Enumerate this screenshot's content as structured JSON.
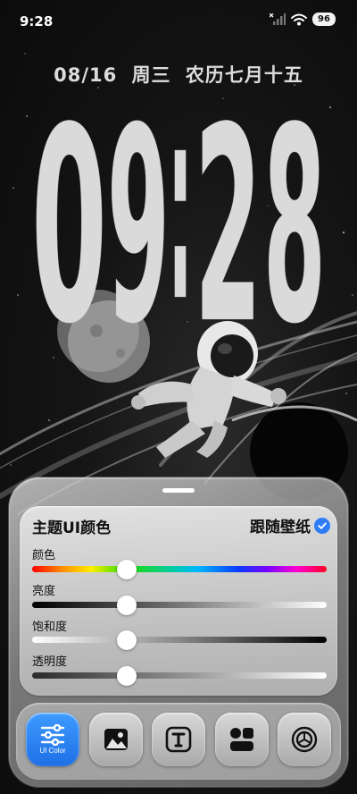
{
  "status_bar": {
    "time": "9:28",
    "battery": "96"
  },
  "lockscreen": {
    "date": "08/16",
    "weekday": "周三",
    "lunar_date": "农历七月十五",
    "clock_digits": [
      "0",
      "9",
      ":",
      "2",
      "8"
    ]
  },
  "panel": {
    "title": "主题UI颜色",
    "follow_wallpaper_label": "跟随壁纸",
    "follow_wallpaper_checked": true,
    "sliders": [
      {
        "label": "颜色",
        "value": 0.32,
        "track": "hue"
      },
      {
        "label": "亮度",
        "value": 0.32,
        "track": "brightness"
      },
      {
        "label": "饱和度",
        "value": 0.32,
        "track": "saturation"
      },
      {
        "label": "透明度",
        "value": 0.32,
        "track": "opacity"
      }
    ]
  },
  "dock": {
    "items": [
      {
        "icon": "sliders-icon",
        "label": "UI Color",
        "active": true
      },
      {
        "icon": "image-icon",
        "label": "",
        "active": false
      },
      {
        "icon": "text-t-icon",
        "label": "",
        "active": false
      },
      {
        "icon": "widgets-icon",
        "label": "",
        "active": false
      },
      {
        "icon": "settings-gear-icon",
        "label": "",
        "active": false
      }
    ]
  },
  "colors": {
    "accent": "#2f7cf6",
    "active_dock": "#2a86f5",
    "clock": "#dddddd"
  }
}
